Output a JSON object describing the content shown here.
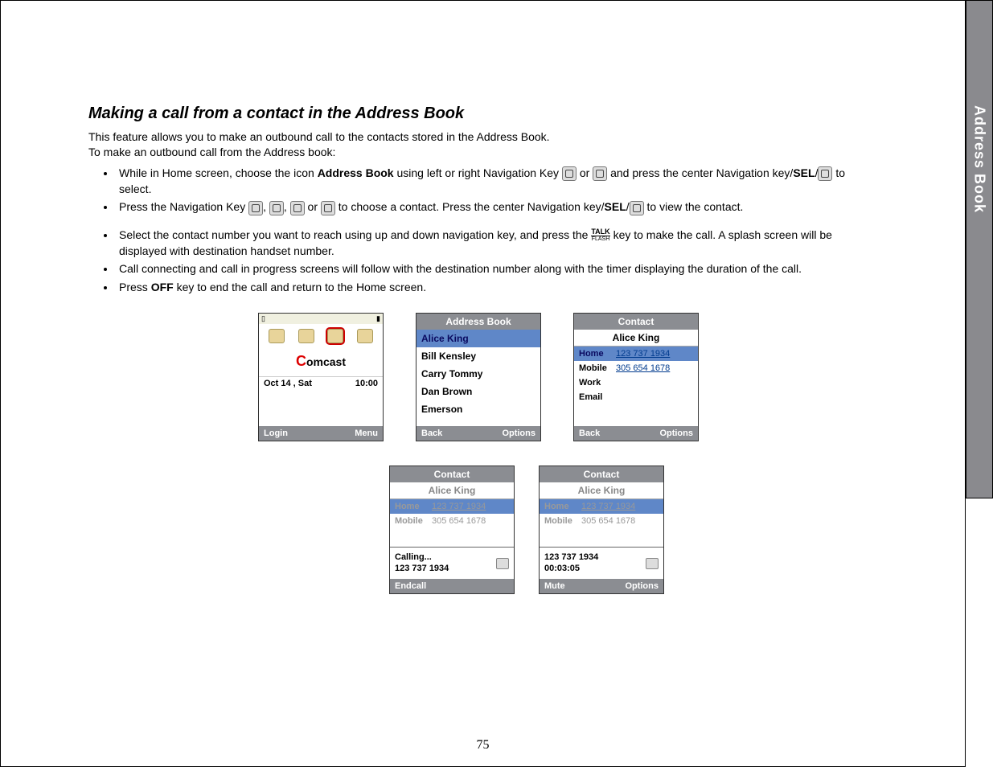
{
  "side_tab": "Address Book",
  "heading": "Making a call from a contact in the Address Book",
  "intro_line1": "This feature allows you to make an outbound call to the contacts stored in the Address Book.",
  "intro_line2": "To make an outbound call from the Address book:",
  "bullets": {
    "b1a": "While in Home screen, choose the icon ",
    "b1_bold1": "Address Book",
    "b1b": " using left or right Navigation Key ",
    "b1_or": " or ",
    "b1c": " and press the center Navigation key/",
    "b1_bold2": "SEL",
    "b1d": "/",
    "b1e": " to select.",
    "b2a": "Press the Navigation Key ",
    "b2_sep": ", ",
    "b2_or": " or ",
    "b2b": " to choose a contact. Press the center Navigation key/",
    "b2_bold": "SEL",
    "b2c": "/",
    "b2d": " to view the contact.",
    "b3a": "Select the contact number you want to reach using up and down navigation key, and press the ",
    "b3_talk_top": "TALK",
    "b3_talk_bot": "FLASH",
    "b3b": " key to make the call. A splash screen will be displayed with destination handset number.",
    "b4": "Call connecting and call in progress screens will follow with the destination number along with the timer displaying the duration of the call.",
    "b5a": "Press ",
    "b5_bold": "OFF",
    "b5b": " key to end the call and return to the Home screen."
  },
  "screen_home": {
    "brand": "Comcast",
    "date": "Oct 14 , Sat",
    "time": "10:00",
    "soft_left": "Login",
    "soft_right": "Menu"
  },
  "screen_ab": {
    "title": "Address Book",
    "rows": [
      "Alice King",
      "Bill Kensley",
      "Carry Tommy",
      "Dan Brown",
      "Emerson"
    ],
    "soft_left": "Back",
    "soft_right": "Options"
  },
  "screen_contact": {
    "title": "Contact",
    "name": "Alice King",
    "fields": [
      {
        "label": "Home",
        "value": "123 737 1934"
      },
      {
        "label": "Mobile",
        "value": "305 654 1678"
      },
      {
        "label": "Work",
        "value": ""
      },
      {
        "label": "Email",
        "value": ""
      }
    ],
    "soft_left": "Back",
    "soft_right": "Options"
  },
  "screen_calling": {
    "title": "Contact",
    "name": "Alice King",
    "fields": [
      {
        "label": "Home",
        "value": "123 737 1934"
      },
      {
        "label": "Mobile",
        "value": "305 654 1678"
      }
    ],
    "overlay_line1": "Calling...",
    "overlay_line2": "123 737 1934",
    "soft_left": "Endcall",
    "soft_right": ""
  },
  "screen_incall": {
    "title": "Contact",
    "name": "Alice King",
    "fields": [
      {
        "label": "Home",
        "value": "123 737 1934"
      },
      {
        "label": "Mobile",
        "value": "305 654 1678"
      }
    ],
    "overlay_line1": "123 737 1934",
    "overlay_line2": "00:03:05",
    "soft_left": "Mute",
    "soft_right": "Options"
  },
  "page_number": "75"
}
